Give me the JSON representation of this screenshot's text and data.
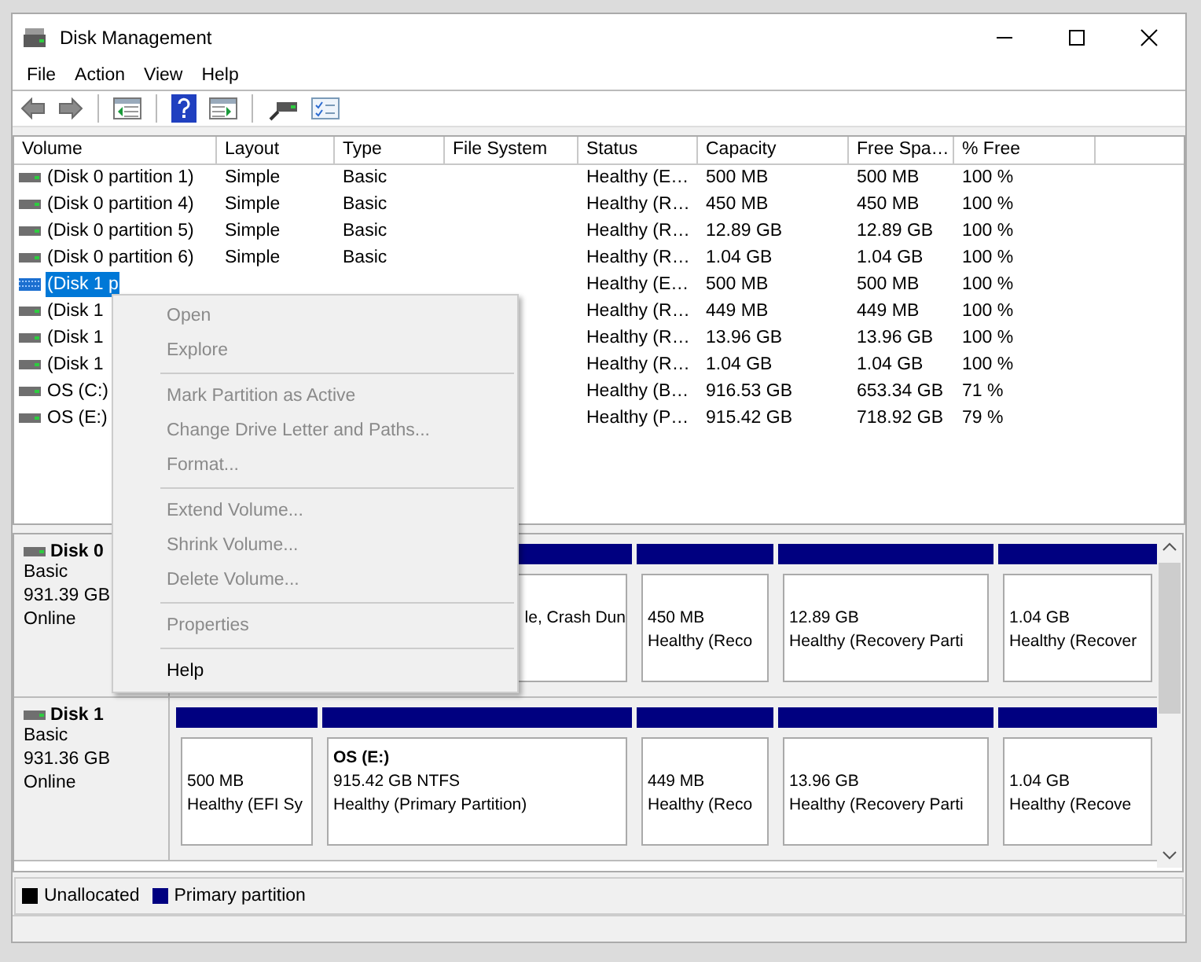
{
  "window": {
    "title": "Disk Management"
  },
  "menu": [
    "File",
    "Action",
    "View",
    "Help"
  ],
  "columns": [
    "Volume",
    "Layout",
    "Type",
    "File System",
    "Status",
    "Capacity",
    "Free Spa…",
    "% Free"
  ],
  "rows": [
    {
      "volume": "(Disk 0 partition 1)",
      "layout": "Simple",
      "type": "Basic",
      "status": "Healthy (E…",
      "capacity": "500 MB",
      "free": "500 MB",
      "percent": "100 %",
      "selected": false
    },
    {
      "volume": "(Disk 0 partition 4)",
      "layout": "Simple",
      "type": "Basic",
      "status": "Healthy (R…",
      "capacity": "450 MB",
      "free": "450 MB",
      "percent": "100 %",
      "selected": false
    },
    {
      "volume": "(Disk 0 partition 5)",
      "layout": "Simple",
      "type": "Basic",
      "status": "Healthy (R…",
      "capacity": "12.89 GB",
      "free": "12.89 GB",
      "percent": "100 %",
      "selected": false
    },
    {
      "volume": "(Disk 0 partition 6)",
      "layout": "Simple",
      "type": "Basic",
      "status": "Healthy (R…",
      "capacity": "1.04 GB",
      "free": "1.04 GB",
      "percent": "100 %",
      "selected": false
    },
    {
      "volume": "(Disk 1 p",
      "status": "Healthy (E…",
      "capacity": "500 MB",
      "free": "500 MB",
      "percent": "100 %",
      "selected": true
    },
    {
      "volume": "(Disk 1",
      "status": "Healthy (R…",
      "capacity": "449 MB",
      "free": "449 MB",
      "percent": "100 %",
      "selected": false
    },
    {
      "volume": "(Disk 1",
      "status": "Healthy (R…",
      "capacity": "13.96 GB",
      "free": "13.96 GB",
      "percent": "100 %",
      "selected": false
    },
    {
      "volume": "(Disk 1",
      "status": "Healthy (R…",
      "capacity": "1.04 GB",
      "free": "1.04 GB",
      "percent": "100 %",
      "selected": false
    },
    {
      "volume": "OS (C:)",
      "status": "Healthy (B…",
      "capacity": "916.53 GB",
      "free": "653.34 GB",
      "percent": "71 %",
      "selected": false
    },
    {
      "volume": "OS (E:)",
      "status": "Healthy (P…",
      "capacity": "915.42 GB",
      "free": "718.92 GB",
      "percent": "79 %",
      "selected": false
    }
  ],
  "disks": [
    {
      "name": "Disk 0",
      "type": "Basic",
      "size": "931.39 GB",
      "state": "Online",
      "partitions": [
        {
          "kind": "clipped",
          "text": "le, Crash Dun"
        },
        {
          "kind": "normal",
          "size": "450 MB",
          "status": "Healthy (Reco"
        },
        {
          "kind": "normal",
          "size": "12.89 GB",
          "status": "Healthy (Recovery Parti"
        },
        {
          "kind": "normal",
          "size": "1.04 GB",
          "status": "Healthy (Recover"
        }
      ]
    },
    {
      "name": "Disk 1",
      "type": "Basic",
      "size": "931.36 GB",
      "state": "Online",
      "partitions": [
        {
          "kind": "normal",
          "size": "500 MB",
          "status": "Healthy (EFI Sy"
        },
        {
          "kind": "normal",
          "title": "OS  (E:)",
          "size": "915.42 GB NTFS",
          "status": "Healthy (Primary Partition)"
        },
        {
          "kind": "normal",
          "size": "449 MB",
          "status": "Healthy (Reco"
        },
        {
          "kind": "normal",
          "size": "13.96 GB",
          "status": "Healthy (Recovery Parti"
        },
        {
          "kind": "normal",
          "size": "1.04 GB",
          "status": "Healthy (Recove"
        }
      ]
    }
  ],
  "legend": [
    {
      "label": "Unallocated",
      "color": "#000000"
    },
    {
      "label": "Primary partition",
      "color": "#000080"
    }
  ],
  "context_menu": [
    {
      "kind": "item",
      "label": "Open",
      "disabled": true
    },
    {
      "kind": "item",
      "label": "Explore",
      "disabled": true
    },
    {
      "kind": "separator"
    },
    {
      "kind": "item",
      "label": "Mark Partition as Active",
      "disabled": true
    },
    {
      "kind": "item",
      "label": "Change Drive Letter and Paths...",
      "disabled": true
    },
    {
      "kind": "item",
      "label": "Format...",
      "disabled": true
    },
    {
      "kind": "separator"
    },
    {
      "kind": "item",
      "label": "Extend Volume...",
      "disabled": true
    },
    {
      "kind": "item",
      "label": "Shrink Volume...",
      "disabled": true
    },
    {
      "kind": "item",
      "label": "Delete Volume...",
      "disabled": true
    },
    {
      "kind": "separator"
    },
    {
      "kind": "item",
      "label": "Properties",
      "disabled": true
    },
    {
      "kind": "separator"
    },
    {
      "kind": "item",
      "label": "Help",
      "disabled": false
    }
  ]
}
